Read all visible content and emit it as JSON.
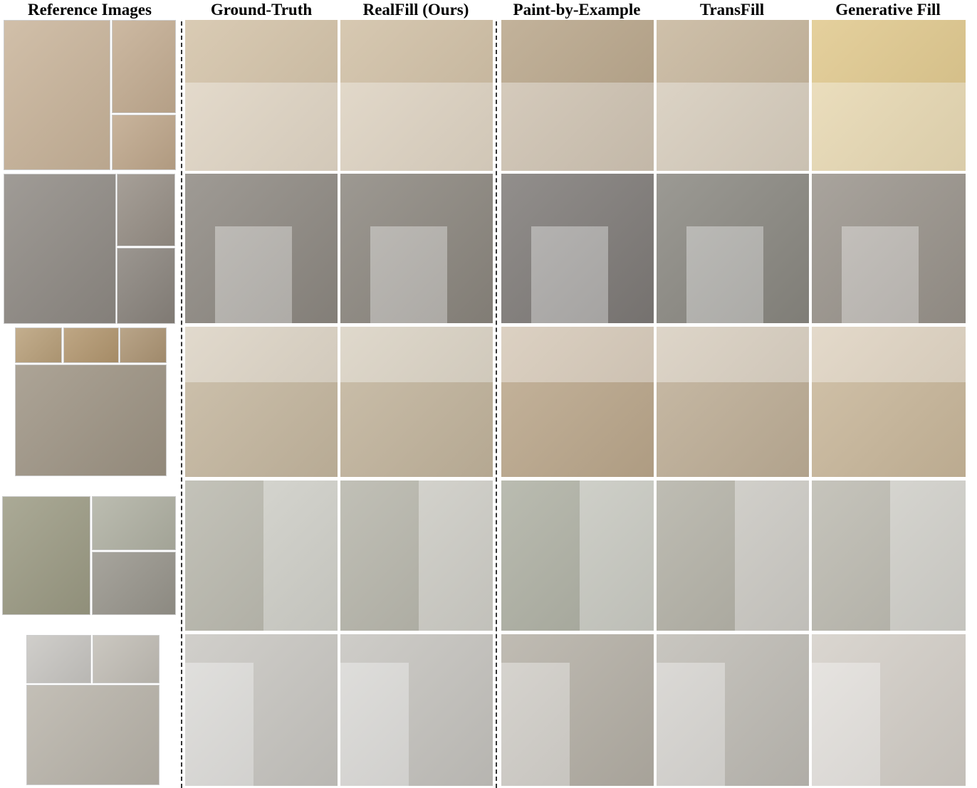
{
  "headers": {
    "reference": "Reference Images",
    "ground_truth": "Ground-Truth",
    "realfill": "RealFill (Ours)",
    "paint_by_example": "Paint-by-Example",
    "transfill": "TransFill",
    "generative_fill": "Generative Fill"
  },
  "row_colors": [
    "#c9b49a",
    "#8f8a84",
    "#b9a07a",
    "#b7b3a8",
    "#c8c6c2"
  ],
  "method_colors": {
    "ground_truth": "#cfc7bb",
    "realfill": "#cbc3b7",
    "paint_by_example": "#a99784",
    "transfill": "#b1a89b",
    "generative_fill": "#d9c7a2"
  }
}
